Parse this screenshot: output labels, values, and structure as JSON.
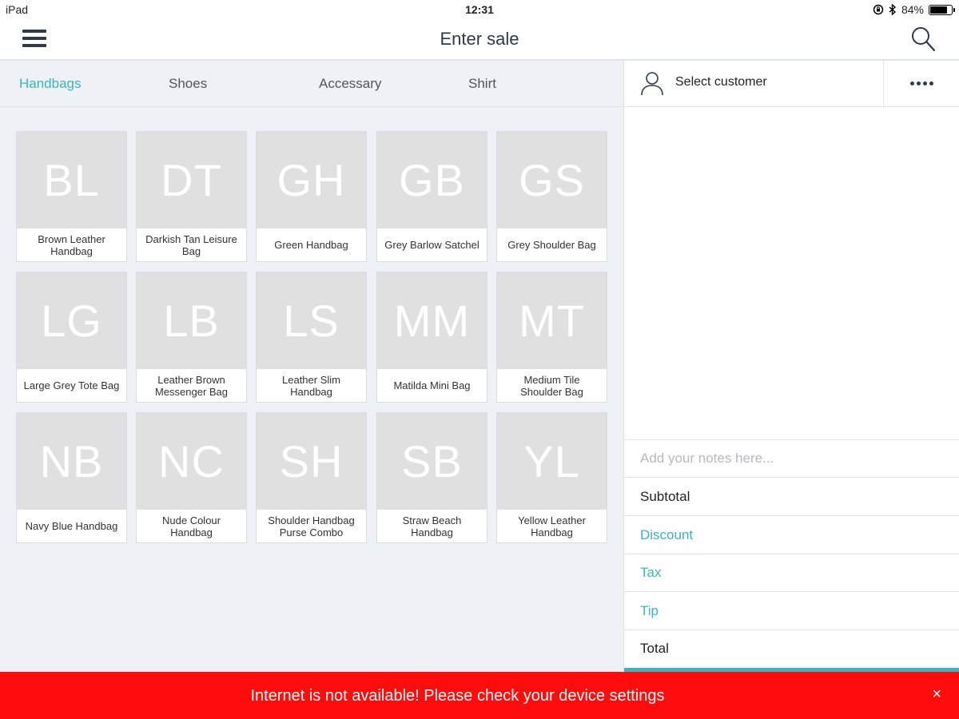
{
  "status_bar": {
    "device": "iPad",
    "time": "12:31",
    "battery_percent": "84%",
    "battery_level": 0.84
  },
  "nav": {
    "title": "Enter sale"
  },
  "tabs": [
    {
      "label": "Handbags",
      "active": true
    },
    {
      "label": "Shoes",
      "active": false
    },
    {
      "label": "Accessary",
      "active": false
    },
    {
      "label": "Shirt",
      "active": false
    }
  ],
  "products": [
    {
      "initials": "BL",
      "name": "Brown Leather Handbag"
    },
    {
      "initials": "DT",
      "name": "Darkish Tan Leisure Bag"
    },
    {
      "initials": "GH",
      "name": "Green Handbag"
    },
    {
      "initials": "GB",
      "name": "Grey Barlow Satchel"
    },
    {
      "initials": "GS",
      "name": "Grey Shoulder Bag"
    },
    {
      "initials": "LG",
      "name": "Large Grey Tote Bag"
    },
    {
      "initials": "LB",
      "name": "Leather Brown Messenger Bag"
    },
    {
      "initials": "LS",
      "name": "Leather Slim Handbag"
    },
    {
      "initials": "MM",
      "name": "Matilda Mini Bag"
    },
    {
      "initials": "MT",
      "name": "Medium Tile Shoulder Bag"
    },
    {
      "initials": "NB",
      "name": "Navy Blue Handbag"
    },
    {
      "initials": "NC",
      "name": "Nude Colour Handbag"
    },
    {
      "initials": "SH",
      "name": "Shoulder Handbag Purse Combo"
    },
    {
      "initials": "SB",
      "name": "Straw Beach Handbag"
    },
    {
      "initials": "YL",
      "name": "Yellow Leather Handbag"
    }
  ],
  "sale": {
    "customer_label": "Select customer",
    "notes_placeholder": "Add your notes here...",
    "subtotal_label": "Subtotal",
    "discount_label": "Discount",
    "tax_label": "Tax",
    "tip_label": "Tip",
    "total_label": "Total"
  },
  "banner": {
    "message": "Internet is not available! Please check your device settings",
    "close": "×"
  },
  "colors": {
    "accent": "#3bb4bd",
    "error": "#ff0c0c",
    "tile_placeholder": "#e0e0e0"
  }
}
